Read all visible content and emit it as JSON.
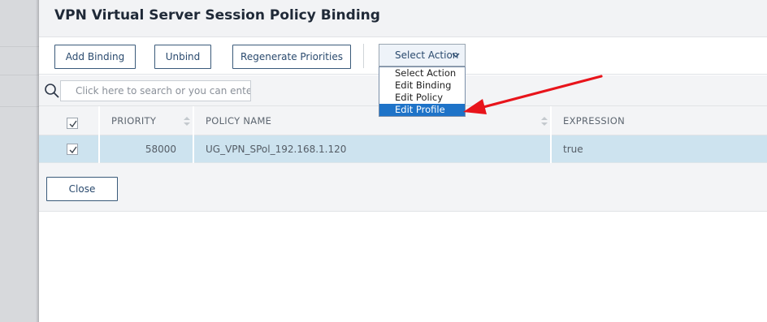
{
  "dialog": {
    "title": "VPN Virtual Server Session Policy Binding"
  },
  "toolbar": {
    "add_binding": "Add Binding",
    "unbind": "Unbind",
    "regenerate": "Regenerate Priorities",
    "select_action": {
      "value": "Select Action",
      "options": [
        "Select Action",
        "Edit Binding",
        "Edit Policy",
        "Edit Profile"
      ],
      "highlighted": "Edit Profile"
    }
  },
  "search": {
    "placeholder": "Click here to search or you can ente"
  },
  "table": {
    "headers": {
      "priority": "PRIORITY",
      "policy_name": "POLICY NAME",
      "expression": "EXPRESSION"
    },
    "rows": [
      {
        "checked": true,
        "priority": "58000",
        "policy_name": "UG_VPN_SPol_192.168.1.120",
        "expression": "true"
      }
    ]
  },
  "footer": {
    "close": "Close"
  },
  "colors": {
    "accent": "#1e73c8",
    "selected_row": "#cde3ef",
    "annotation_arrow": "#e8141b"
  }
}
